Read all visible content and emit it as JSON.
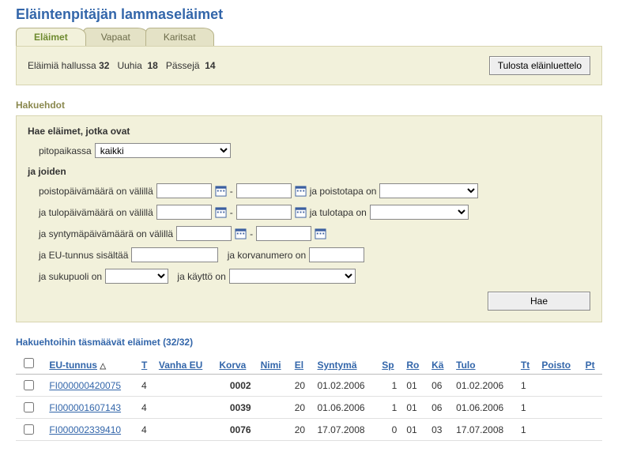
{
  "title": "Eläintenpitäjän lammaseläimet",
  "tabs": {
    "animals": "Eläimet",
    "vapaat": "Vapaat",
    "karitsat": "Karitsat"
  },
  "summary": {
    "held_label": "Eläimiä hallussa",
    "held_value": "32",
    "ewes_label": "Uuhia",
    "ewes_value": "18",
    "rams_label": "Pässejä",
    "rams_value": "14",
    "print_btn": "Tulosta eläinluettelo"
  },
  "criteria": {
    "section_title": "Hakuehdot",
    "head1": "Hae eläimet, jotka ovat",
    "pitopaikassa_label": "pitopaikassa",
    "pitopaikassa_value": "kaikki",
    "head2": "ja joiden",
    "row_poisto": "poistopäivämäärä on välillä",
    "dash": "-",
    "ja_poistotapa": "ja poistotapa on",
    "row_tulo": "ja tulopäivämäärä on välillä",
    "ja_tulotapa": "ja tulotapa on",
    "row_synt": "ja syntymäpäivämäärä on välillä",
    "row_eu": "ja EU-tunnus sisältää",
    "ja_korva": "ja korvanumero on",
    "row_sp": "ja sukupuoli on",
    "ja_kaytto": "ja käyttö on",
    "hae_btn": "Hae"
  },
  "results": {
    "title": "Hakuehtoihin täsmäävät eläimet (32/32)",
    "cols": {
      "eu": "EU-tunnus",
      "t": "T",
      "vanha": "Vanha EU",
      "korva": "Korva",
      "nimi": "Nimi",
      "el": "El",
      "syntyma": "Syntymä",
      "sp": "Sp",
      "ro": "Ro",
      "ka": "Kä",
      "tulo": "Tulo",
      "tt": "Tt",
      "poisto": "Poisto",
      "pt": "Pt"
    },
    "rows": [
      {
        "eu": "FI000000420075",
        "t": "4",
        "vanha": "",
        "korva": "0002",
        "nimi": "",
        "el": "20",
        "syntyma": "01.02.2006",
        "sp": "1",
        "ro": "01",
        "ka": "06",
        "tulo": "01.02.2006",
        "tt": "1",
        "poisto": "",
        "pt": ""
      },
      {
        "eu": "FI000001607143",
        "t": "4",
        "vanha": "",
        "korva": "0039",
        "nimi": "",
        "el": "20",
        "syntyma": "01.06.2006",
        "sp": "1",
        "ro": "01",
        "ka": "06",
        "tulo": "01.06.2006",
        "tt": "1",
        "poisto": "",
        "pt": ""
      },
      {
        "eu": "FI000002339410",
        "t": "4",
        "vanha": "",
        "korva": "0076",
        "nimi": "",
        "el": "20",
        "syntyma": "17.07.2008",
        "sp": "0",
        "ro": "01",
        "ka": "03",
        "tulo": "17.07.2008",
        "tt": "1",
        "poisto": "",
        "pt": ""
      }
    ]
  }
}
